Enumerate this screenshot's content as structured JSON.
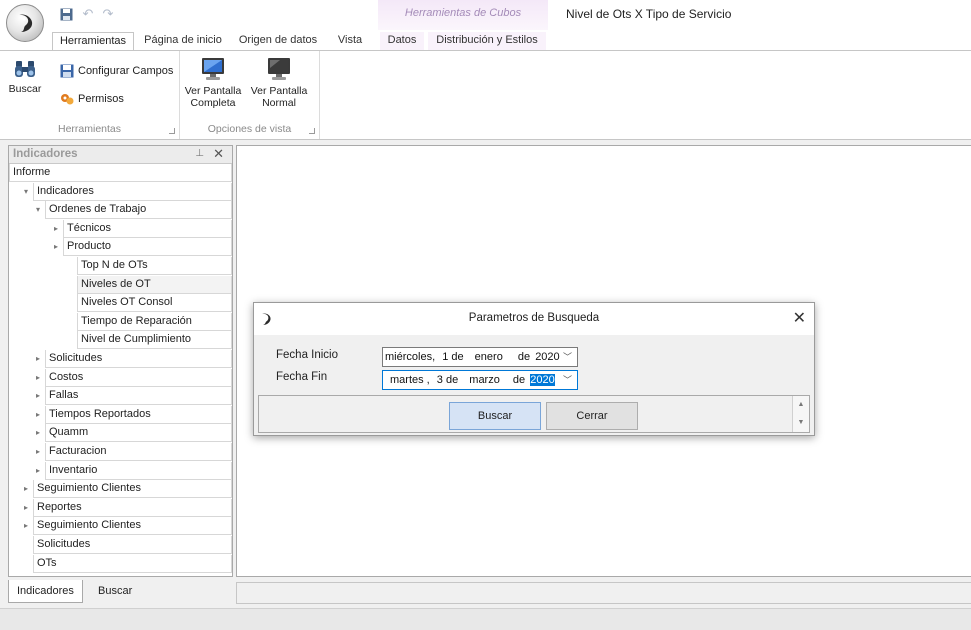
{
  "window": {
    "title": "Nivel de Ots X Tipo de Servicio",
    "context_group": "Herramientas de Cubos"
  },
  "ribbon_tabs": [
    {
      "label": "Herramientas",
      "active": true
    },
    {
      "label": "Página de inicio"
    },
    {
      "label": "Origen de datos"
    },
    {
      "label": "Vista"
    },
    {
      "label": "Datos"
    },
    {
      "label": "Distribución y Estilos"
    }
  ],
  "ribbon": {
    "herramientas": {
      "group_label": "Herramientas",
      "buscar": "Buscar",
      "configurar_campos": "Configurar Campos",
      "permisos": "Permisos"
    },
    "opciones_vista": {
      "group_label": "Opciones de vista",
      "pantalla_completa": "Ver Pantalla Completa",
      "pantalla_completa_l1": "Ver Pantalla",
      "pantalla_completa_l2": "Completa",
      "pantalla_normal_l1": "Ver Pantalla",
      "pantalla_normal_l2": "Normal"
    }
  },
  "dock": {
    "title": "Indicadores",
    "pin": "⊥",
    "close": "✕",
    "tree": [
      {
        "label": "Informe",
        "level": 0,
        "arrow": ""
      },
      {
        "label": "Indicadores",
        "level": 1,
        "arrow": "▾"
      },
      {
        "label": "Ordenes de Trabajo",
        "level": 2,
        "arrow": "▾"
      },
      {
        "label": "Técnicos",
        "level": 3,
        "arrow": "▸"
      },
      {
        "label": "Producto",
        "level": 3,
        "arrow": "▸"
      },
      {
        "label": "Top N de OTs",
        "level": 4,
        "arrow": ""
      },
      {
        "label": "Niveles de OT",
        "level": 4,
        "arrow": "",
        "selected": true
      },
      {
        "label": "Niveles OT Consol",
        "level": 4,
        "arrow": ""
      },
      {
        "label": "Tiempo de Reparación",
        "level": 4,
        "arrow": ""
      },
      {
        "label": "Nivel de Cumplimiento",
        "level": 4,
        "arrow": ""
      },
      {
        "label": "Solicitudes",
        "level": 2,
        "arrow": "▸"
      },
      {
        "label": "Costos",
        "level": 2,
        "arrow": "▸"
      },
      {
        "label": "Fallas",
        "level": 2,
        "arrow": "▸"
      },
      {
        "label": "Tiempos Reportados",
        "level": 2,
        "arrow": "▸"
      },
      {
        "label": "Quamm",
        "level": 2,
        "arrow": "▸"
      },
      {
        "label": "Facturacion",
        "level": 2,
        "arrow": "▸"
      },
      {
        "label": "Inventario",
        "level": 2,
        "arrow": "▸"
      },
      {
        "label": "Seguimiento Clientes",
        "level": 1,
        "arrow": "▸"
      },
      {
        "label": "Reportes",
        "level": 1,
        "arrow": "▸"
      },
      {
        "label": "Seguimiento Clientes",
        "level": 1,
        "arrow": "▸"
      },
      {
        "label": "Solicitudes",
        "level": 1,
        "arrow": ""
      },
      {
        "label": "OTs",
        "level": 1,
        "arrow": ""
      }
    ],
    "tabs": [
      {
        "label": "Indicadores",
        "active": true
      },
      {
        "label": "Buscar"
      }
    ]
  },
  "dialog": {
    "title": "Parametros de Busqueda",
    "close": "✕",
    "fecha_inicio_label": "Fecha Inicio",
    "fecha_fin_label": "Fecha Fin",
    "fecha_inicio": {
      "weekday": "miércoles,",
      "day": "1 de",
      "month": "enero",
      "de": "de",
      "year": "2020"
    },
    "fecha_fin": {
      "weekday": "martes ,",
      "day": "3 de",
      "month": "marzo",
      "de": "de",
      "year": "2020"
    },
    "buscar_button": "Buscar",
    "cerrar_button": "Cerrar"
  },
  "colors": {
    "accent": "#0078d7",
    "context_tab": "#a48bb8"
  }
}
